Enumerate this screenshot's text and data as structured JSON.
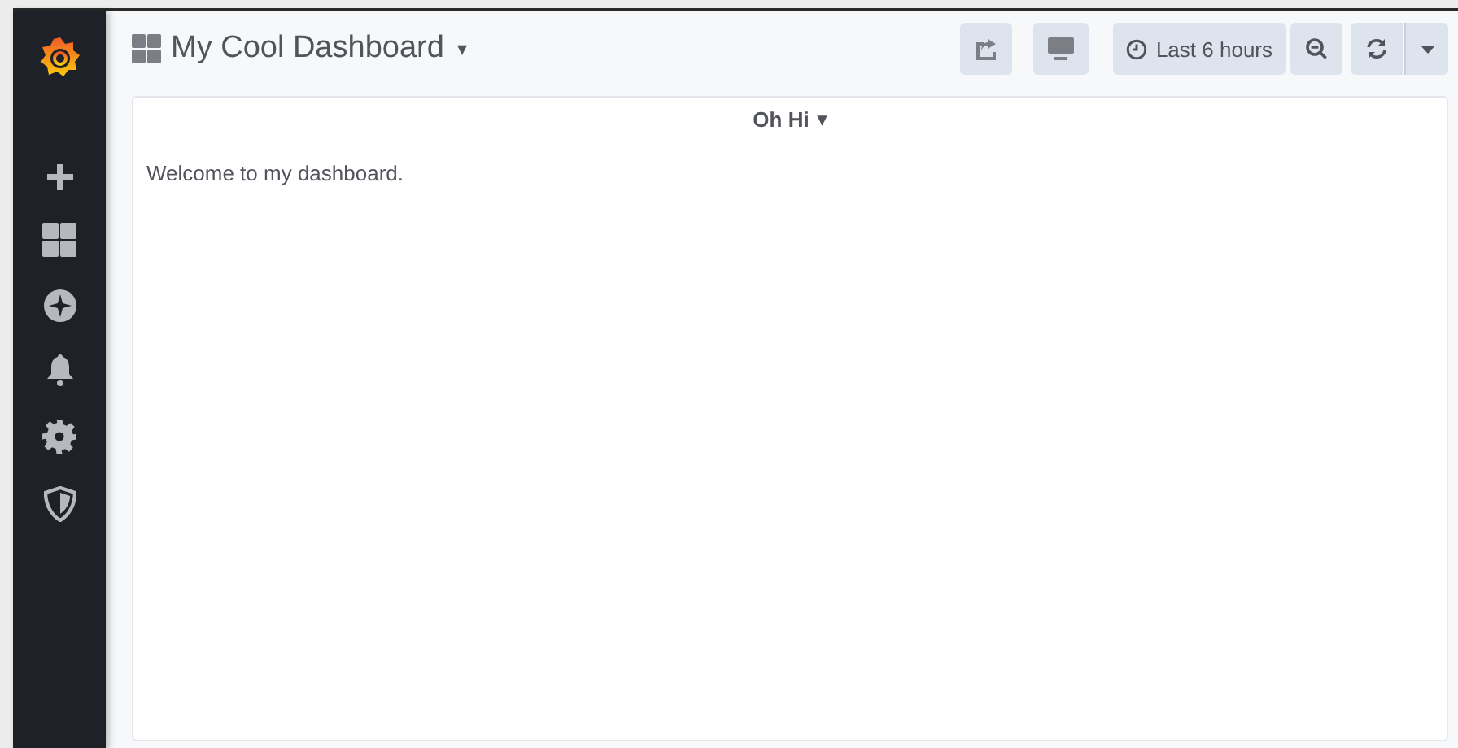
{
  "dashboard": {
    "title": "My Cool Dashboard",
    "caret": "▾"
  },
  "time_picker": {
    "label": "Last 6 hours"
  },
  "panel": {
    "title": "Oh Hi",
    "caret": "▾",
    "text": "Welcome to my dashboard."
  }
}
